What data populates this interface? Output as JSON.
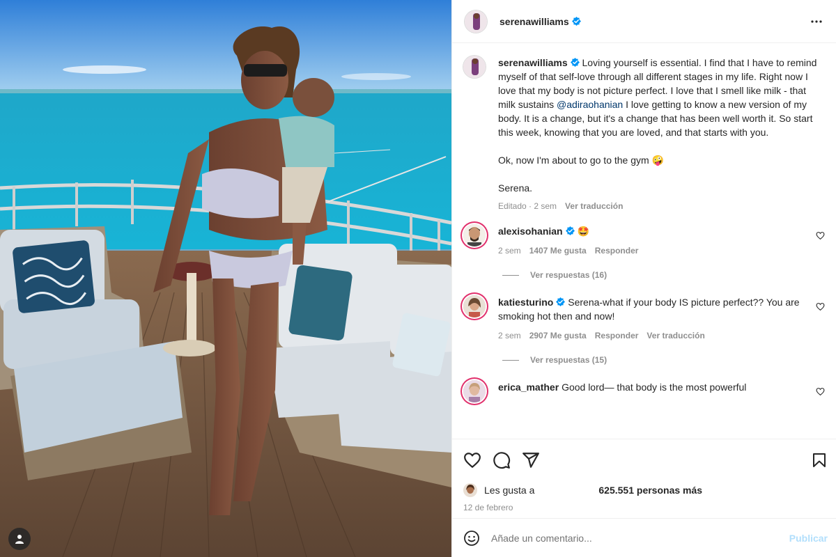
{
  "colors": {
    "verified": "#0095f6",
    "link": "#00376b",
    "muted": "#8e8e8e",
    "publish_disabled": "#b2dffc"
  },
  "media": {
    "icon": "user-tag-icon"
  },
  "header": {
    "username": "serenawilliams",
    "more_icon": "more-horizontal-icon"
  },
  "caption": {
    "username": "serenawilliams",
    "text_before_mention": "Loving yourself is essential. I find that I have to remind myself of that self-love through all different stages in my life. Right now I love that my body is not picture perfect. I love that I smell like milk - that milk sustains ",
    "mention": "@adiraohanian",
    "text_after_mention": " I love getting to know a new version of my body. It is a change, but it's a change that has been well worth it. So start this week, knowing that you are loved, and that starts with you.",
    "paragraph2": "Ok, now I'm about to go to the gym 🤪",
    "paragraph3": "Serena.",
    "edited": "Editado · 2 sem",
    "translate": "Ver traducción"
  },
  "comments": [
    {
      "username": "alexisohanian",
      "text": "🤩",
      "time": "2 sem",
      "likes": "1407 Me gusta",
      "reply": "Responder",
      "translate": "",
      "view_replies": "Ver respuestas (16)"
    },
    {
      "username": "katiesturino",
      "text": "Serena-what if your body IS picture perfect?? You are smoking hot then and now!",
      "time": "2 sem",
      "likes": "2907 Me gusta",
      "reply": "Responder",
      "translate": "Ver traducción",
      "view_replies": "Ver respuestas (15)"
    },
    {
      "username": "erica_mather",
      "text": "Good lord— that body is the most powerful"
    }
  ],
  "actions": {
    "like_icon": "heart-icon",
    "comment_icon": "comment-icon",
    "share_icon": "share-icon",
    "save_icon": "bookmark-icon"
  },
  "likes": {
    "prefix": "Les gusta a",
    "count": "625.551 personas más"
  },
  "date": "12 de febrero",
  "add_comment": {
    "placeholder": "Añade un comentario...",
    "publish": "Publicar",
    "emoji_icon": "emoji-icon"
  }
}
